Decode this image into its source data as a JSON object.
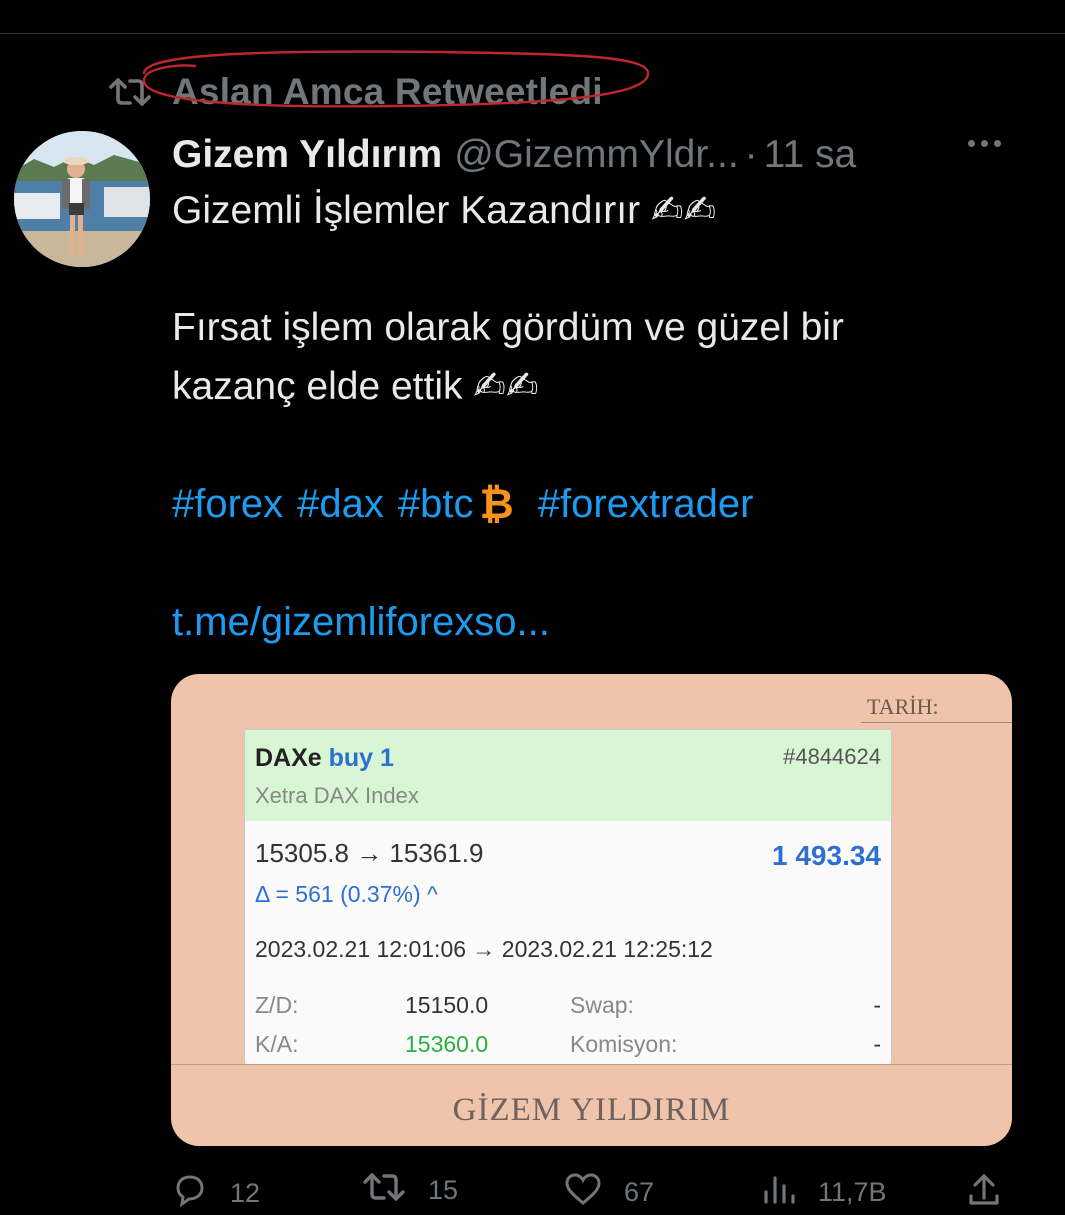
{
  "retweet": {
    "label": "Aslan Amca Retweetledi",
    "icon": "retweet-icon",
    "highlight_color": "#c0262d"
  },
  "tweet": {
    "name": "Gizem Yıldırım",
    "handle": "@GizemmYldr...",
    "separator": "·",
    "time": "11 sa",
    "lines": [
      "Gizemli İşlemler Kazandırır ✍✍",
      "Fırsat işlem olarak gördüm ve güzel bir",
      "kazanç elde ettik ✍✍"
    ],
    "hashtags": [
      "#forex",
      "#dax",
      "#btc"
    ],
    "btc_symbol": "₿",
    "hashtag_last": "#forextrader",
    "link": "t.me/gizemliforexso..."
  },
  "media": {
    "tarih_label": "TARİH:",
    "symbol": "DAXe",
    "direction": "buy 1",
    "instrument": "Xetra DAX Index",
    "ticket": "#4844624",
    "prices": "15305.8 → 15361.9",
    "profit": "1 493.34",
    "delta": "Δ = 561 (0.37%) ^",
    "dates": "2023.02.21 12:01:06 → 2023.02.21 12:25:12",
    "sl_label": "Z/D:",
    "sl_value": "15150.0",
    "tp_label": "K/A:",
    "tp_value": "15360.0",
    "swap_label": "Swap:",
    "swap_value": "-",
    "commission_label": "Komisyon:",
    "commission_value": "-",
    "watermark": "GİZEM YILDIRIM"
  },
  "actions": {
    "reply": "12",
    "retweet": "15",
    "like": "67",
    "views": "11,7B"
  },
  "colors": {
    "background": "#000000",
    "link": "#1d9bf0",
    "muted": "#71767b",
    "card": "#efc4ab"
  }
}
